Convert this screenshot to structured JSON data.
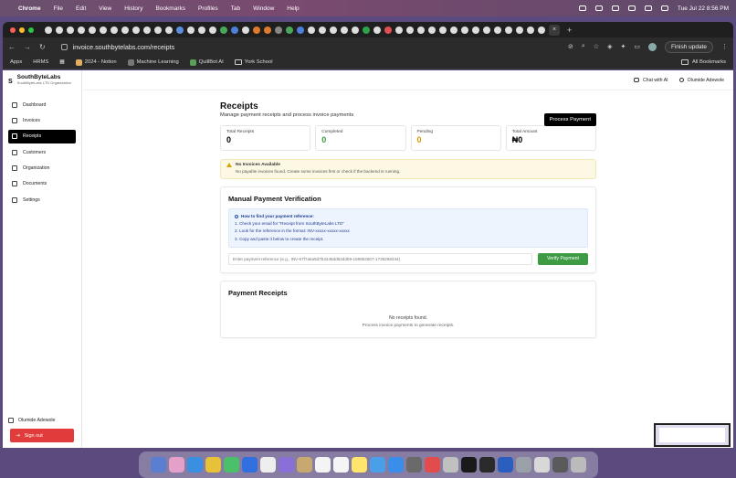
{
  "menubar": {
    "app": "Chrome",
    "items": [
      "File",
      "Edit",
      "View",
      "History",
      "Bookmarks",
      "Profiles",
      "Tab",
      "Window",
      "Help"
    ],
    "clock": "Tue Jul 22  8:56 PM"
  },
  "browser": {
    "url": "invoice.southbytelabs.com/receipts",
    "finish_update": "Finish update",
    "bookmarks": [
      "Apps",
      "HRMS",
      "2024 - Notion",
      "Machine Learning",
      "QuillBot AI",
      "York School"
    ],
    "all_bookmarks": "All Bookmarks"
  },
  "sidebar": {
    "brand": "SouthByteLabs",
    "brand_sub": "SouthByteLabs LTD Organization",
    "logo": "S",
    "items": [
      {
        "label": "Dashboard",
        "icon": "dashboard-icon"
      },
      {
        "label": "Invoices",
        "icon": "invoice-icon"
      },
      {
        "label": "Receipts",
        "icon": "receipt-icon"
      },
      {
        "label": "Customers",
        "icon": "customers-icon"
      },
      {
        "label": "Organization",
        "icon": "organization-icon"
      },
      {
        "label": "Documents",
        "icon": "documents-icon"
      },
      {
        "label": "Settings",
        "icon": "settings-icon"
      }
    ],
    "user": "Olumide Adewole",
    "signout": "Sign out"
  },
  "topbar": {
    "chat": "Chat with AI",
    "user": "Olumide Adewole"
  },
  "page": {
    "title": "Receipts",
    "subtitle": "Manage payment receipts and process invoice payments",
    "process_button": "Process Payment"
  },
  "stats": [
    {
      "label": "Total Receipts",
      "value": "0"
    },
    {
      "label": "Completed",
      "value": "0",
      "color": "#3d9b44"
    },
    {
      "label": "Pending",
      "value": "0",
      "color": "#d49a00"
    },
    {
      "label": "Total Amount",
      "value": "₦0"
    }
  ],
  "alert": {
    "title": "No Invoices Available",
    "desc": "No payable invoices found. Create some invoices first or check if the backend is running."
  },
  "verification": {
    "title": "Manual Payment Verification",
    "howto_title": "How to find your payment reference:",
    "steps": [
      "1. Check your email for \"Receipt from SouthByteLabs LTD\"",
      "2. Look for the reference in the format: INV-xxxxx-xxxxx-xxxxx",
      "3. Copy and paste it below to create the receipt."
    ],
    "input_placeholder": "Enter payment reference (e.g., INV-67f7a6a5d7b3445dd62dd09-159852607-1736268344)",
    "verify_button": "Verify Payment"
  },
  "receipts": {
    "title": "Payment Receipts",
    "empty": "No receipts found.",
    "empty_hint": "Process invoice payments to generate receipts."
  }
}
